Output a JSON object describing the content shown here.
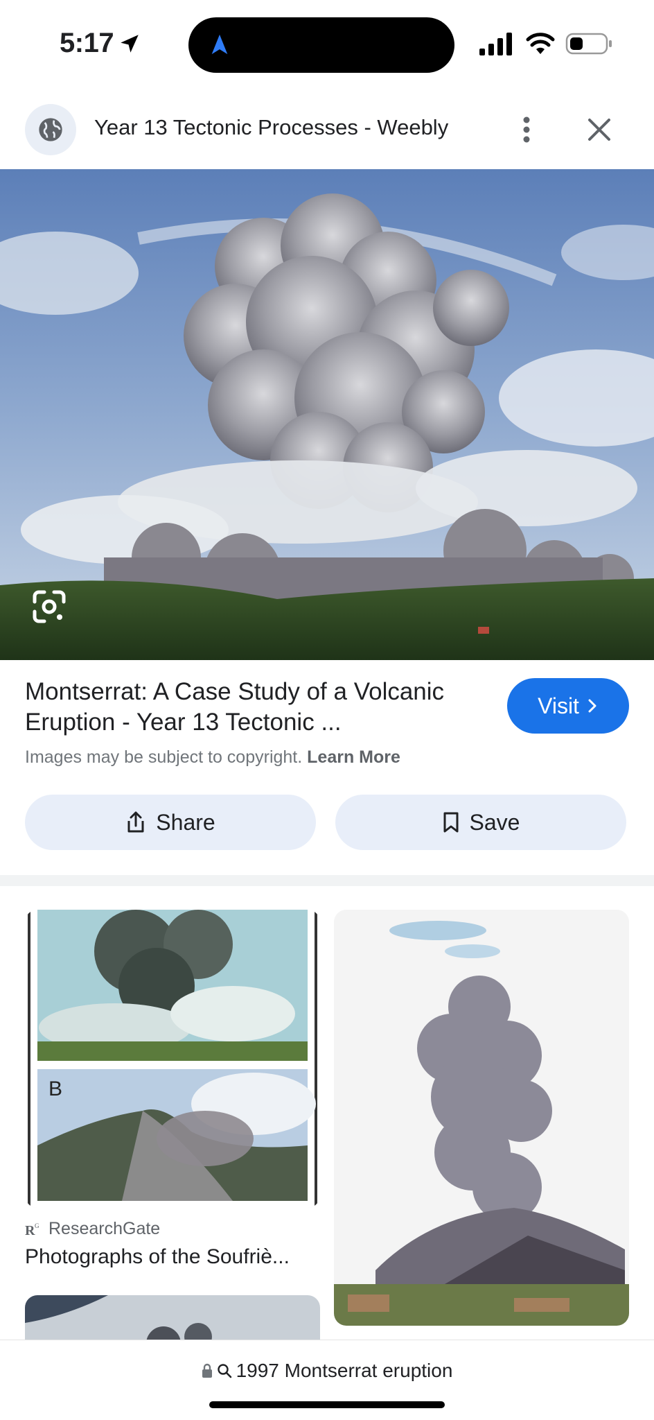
{
  "status_bar": {
    "time": "5:17"
  },
  "header": {
    "title": "Year 13 Tectonic Processes - Weebly"
  },
  "result": {
    "title": "Montserrat: A Case Study of a Volcanic Eruption - Year 13 Tectonic ...",
    "visit_label": "Visit",
    "copyright_text": "Images may be subject to copyright.",
    "learn_more": "Learn More",
    "share_label": "Share",
    "save_label": "Save"
  },
  "related": {
    "card1": {
      "panel_letter": "B",
      "source": "ResearchGate",
      "caption": "Photographs of the Soufriè..."
    }
  },
  "bottom": {
    "query": "1997 Montserrat eruption"
  },
  "colors": {
    "accent": "#1a73e8",
    "chip_bg": "#e8eef9"
  }
}
